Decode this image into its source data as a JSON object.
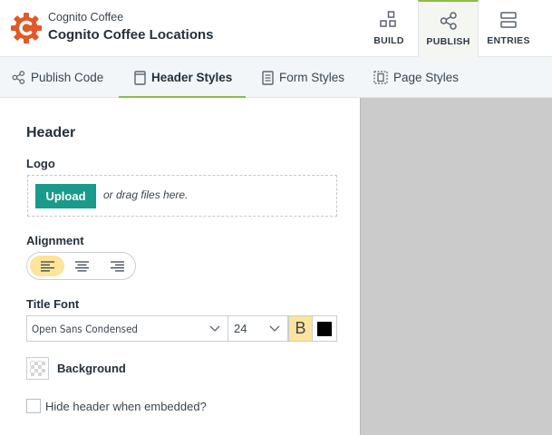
{
  "header": {
    "org_name": "Cognito Coffee",
    "form_title": "Cognito Coffee Locations",
    "brand_color": "#e05a28"
  },
  "nav": [
    {
      "label": "BUILD",
      "icon": "build-grid-icon"
    },
    {
      "label": "PUBLISH",
      "icon": "share-icon",
      "active": true
    },
    {
      "label": "ENTRIES",
      "icon": "entries-list-icon"
    }
  ],
  "subtabs": [
    {
      "label": "Publish Code",
      "icon": "share-icon"
    },
    {
      "label": "Header Styles",
      "icon": "page-icon",
      "active": true
    },
    {
      "label": "Form Styles",
      "icon": "form-icon"
    },
    {
      "label": "Page Styles",
      "icon": "page-layout-icon"
    }
  ],
  "panel": {
    "section_title": "Header",
    "logo_label": "Logo",
    "upload_label": "Upload",
    "drop_text": "or drag files here.",
    "alignment_label": "Alignment",
    "alignment_selected": "left",
    "title_font_label": "Title Font",
    "font_family": "Open Sans Condensed",
    "font_size": "24",
    "bold_active": true,
    "bold_glyph": "B",
    "title_color": "#000000",
    "background_label": "Background",
    "hide_header_label": "Hide header when embedded?",
    "hide_header_checked": false
  },
  "colors": {
    "accent_green": "#8cbd47",
    "upload_teal": "#1a9a8a",
    "toggle_highlight": "#fde49a",
    "preview_bg": "#cbcbcb"
  }
}
